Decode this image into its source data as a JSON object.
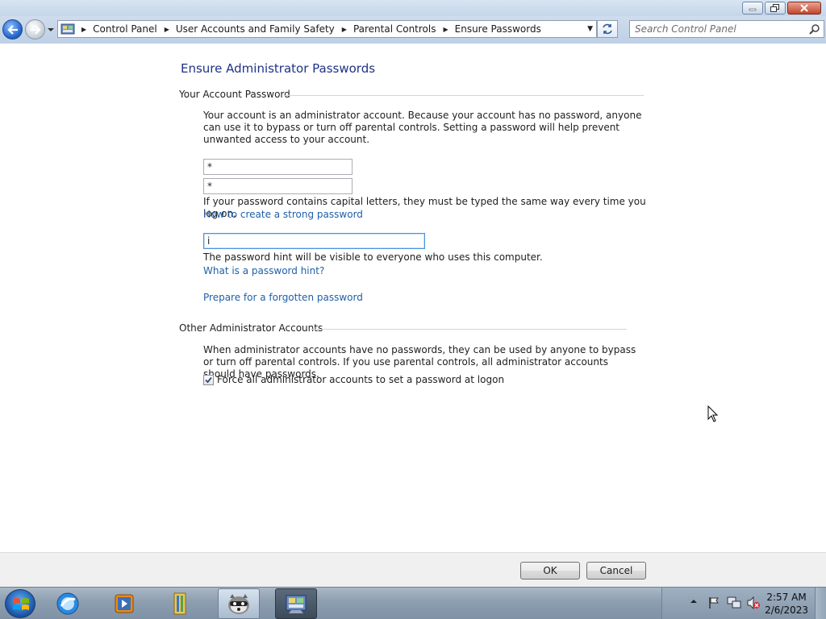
{
  "window": {
    "caption_buttons": [
      "minimize-icon",
      "restore-icon",
      "close-icon"
    ]
  },
  "address_bar": {
    "breadcrumbs": [
      "Control Panel",
      "User Accounts and Family Safety",
      "Parental Controls",
      "Ensure Passwords"
    ],
    "search_placeholder": "Search Control Panel"
  },
  "page": {
    "title": "Ensure Administrator Passwords",
    "your_account": {
      "heading": "Your Account Password",
      "description": "Your account is an administrator account. Because your account has no password, anyone can use it to bypass or turn off parental controls. Setting a password will help prevent unwanted access to your account.",
      "password_value": "*",
      "confirm_value": "*",
      "caps_note": "If your password contains capital letters, they must be typed the same way every time you log on.",
      "strong_password_link": "How to create a strong password",
      "hint_value": "i",
      "hint_note": "The password hint will be visible to everyone who uses this computer.",
      "hint_link": "What is a password hint?",
      "forgotten_link": "Prepare for a forgotten password"
    },
    "other_accounts": {
      "heading": "Other Administrator Accounts",
      "description": "When administrator accounts have no passwords, they can be used by anyone to bypass or turn off parental controls. If you use parental controls, all administrator accounts should have passwords.",
      "checkbox_label": "Force all administrator accounts to set a password at logon",
      "checkbox_checked": true
    }
  },
  "buttons": {
    "ok": "OK",
    "cancel": "Cancel"
  },
  "taskbar": {
    "items": [
      "start-orb",
      "internet-explorer-icon",
      "media-player-icon",
      "explorer-icon",
      "raccoon-app-icon",
      "control-panel-icon"
    ],
    "clock_time": "2:57 AM",
    "clock_date": "2/6/2023"
  },
  "colors": {
    "title_blue": "#1e3287",
    "link_blue": "#1e5fa8"
  }
}
